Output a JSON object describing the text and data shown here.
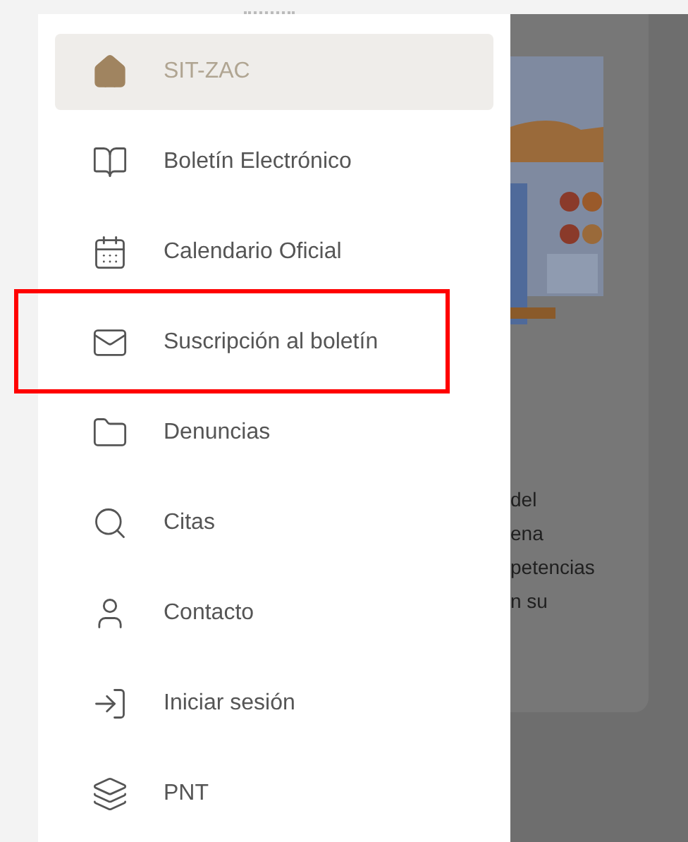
{
  "drawer": {
    "items": [
      {
        "label": "SIT-ZAC",
        "selected": true,
        "highlighted": false
      },
      {
        "label": "Boletín Electrónico",
        "selected": false,
        "highlighted": false
      },
      {
        "label": "Calendario Oficial",
        "selected": false,
        "highlighted": false
      },
      {
        "label": "Suscripción al boletín",
        "selected": false,
        "highlighted": true
      },
      {
        "label": "Denuncias",
        "selected": false,
        "highlighted": false
      },
      {
        "label": "Citas",
        "selected": false,
        "highlighted": false
      },
      {
        "label": "Contacto",
        "selected": false,
        "highlighted": false
      },
      {
        "label": "Iniciar sesión",
        "selected": false,
        "highlighted": false
      },
      {
        "label": "PNT",
        "selected": false,
        "highlighted": false
      }
    ]
  },
  "background_text": [
    "del",
    "ena",
    "petencias",
    "n su"
  ]
}
